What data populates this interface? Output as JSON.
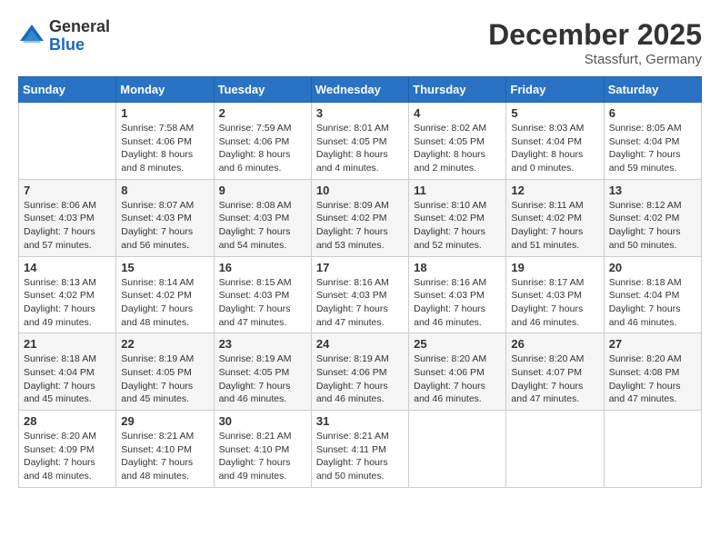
{
  "logo": {
    "general": "General",
    "blue": "Blue"
  },
  "title": "December 2025",
  "location": "Stassfurt, Germany",
  "days_header": [
    "Sunday",
    "Monday",
    "Tuesday",
    "Wednesday",
    "Thursday",
    "Friday",
    "Saturday"
  ],
  "weeks": [
    [
      {
        "day": "",
        "sunrise": "",
        "sunset": "",
        "daylight": ""
      },
      {
        "day": "1",
        "sunrise": "Sunrise: 7:58 AM",
        "sunset": "Sunset: 4:06 PM",
        "daylight": "Daylight: 8 hours and 8 minutes."
      },
      {
        "day": "2",
        "sunrise": "Sunrise: 7:59 AM",
        "sunset": "Sunset: 4:06 PM",
        "daylight": "Daylight: 8 hours and 6 minutes."
      },
      {
        "day": "3",
        "sunrise": "Sunrise: 8:01 AM",
        "sunset": "Sunset: 4:05 PM",
        "daylight": "Daylight: 8 hours and 4 minutes."
      },
      {
        "day": "4",
        "sunrise": "Sunrise: 8:02 AM",
        "sunset": "Sunset: 4:05 PM",
        "daylight": "Daylight: 8 hours and 2 minutes."
      },
      {
        "day": "5",
        "sunrise": "Sunrise: 8:03 AM",
        "sunset": "Sunset: 4:04 PM",
        "daylight": "Daylight: 8 hours and 0 minutes."
      },
      {
        "day": "6",
        "sunrise": "Sunrise: 8:05 AM",
        "sunset": "Sunset: 4:04 PM",
        "daylight": "Daylight: 7 hours and 59 minutes."
      }
    ],
    [
      {
        "day": "7",
        "sunrise": "Sunrise: 8:06 AM",
        "sunset": "Sunset: 4:03 PM",
        "daylight": "Daylight: 7 hours and 57 minutes."
      },
      {
        "day": "8",
        "sunrise": "Sunrise: 8:07 AM",
        "sunset": "Sunset: 4:03 PM",
        "daylight": "Daylight: 7 hours and 56 minutes."
      },
      {
        "day": "9",
        "sunrise": "Sunrise: 8:08 AM",
        "sunset": "Sunset: 4:03 PM",
        "daylight": "Daylight: 7 hours and 54 minutes."
      },
      {
        "day": "10",
        "sunrise": "Sunrise: 8:09 AM",
        "sunset": "Sunset: 4:02 PM",
        "daylight": "Daylight: 7 hours and 53 minutes."
      },
      {
        "day": "11",
        "sunrise": "Sunrise: 8:10 AM",
        "sunset": "Sunset: 4:02 PM",
        "daylight": "Daylight: 7 hours and 52 minutes."
      },
      {
        "day": "12",
        "sunrise": "Sunrise: 8:11 AM",
        "sunset": "Sunset: 4:02 PM",
        "daylight": "Daylight: 7 hours and 51 minutes."
      },
      {
        "day": "13",
        "sunrise": "Sunrise: 8:12 AM",
        "sunset": "Sunset: 4:02 PM",
        "daylight": "Daylight: 7 hours and 50 minutes."
      }
    ],
    [
      {
        "day": "14",
        "sunrise": "Sunrise: 8:13 AM",
        "sunset": "Sunset: 4:02 PM",
        "daylight": "Daylight: 7 hours and 49 minutes."
      },
      {
        "day": "15",
        "sunrise": "Sunrise: 8:14 AM",
        "sunset": "Sunset: 4:02 PM",
        "daylight": "Daylight: 7 hours and 48 minutes."
      },
      {
        "day": "16",
        "sunrise": "Sunrise: 8:15 AM",
        "sunset": "Sunset: 4:03 PM",
        "daylight": "Daylight: 7 hours and 47 minutes."
      },
      {
        "day": "17",
        "sunrise": "Sunrise: 8:16 AM",
        "sunset": "Sunset: 4:03 PM",
        "daylight": "Daylight: 7 hours and 47 minutes."
      },
      {
        "day": "18",
        "sunrise": "Sunrise: 8:16 AM",
        "sunset": "Sunset: 4:03 PM",
        "daylight": "Daylight: 7 hours and 46 minutes."
      },
      {
        "day": "19",
        "sunrise": "Sunrise: 8:17 AM",
        "sunset": "Sunset: 4:03 PM",
        "daylight": "Daylight: 7 hours and 46 minutes."
      },
      {
        "day": "20",
        "sunrise": "Sunrise: 8:18 AM",
        "sunset": "Sunset: 4:04 PM",
        "daylight": "Daylight: 7 hours and 46 minutes."
      }
    ],
    [
      {
        "day": "21",
        "sunrise": "Sunrise: 8:18 AM",
        "sunset": "Sunset: 4:04 PM",
        "daylight": "Daylight: 7 hours and 45 minutes."
      },
      {
        "day": "22",
        "sunrise": "Sunrise: 8:19 AM",
        "sunset": "Sunset: 4:05 PM",
        "daylight": "Daylight: 7 hours and 45 minutes."
      },
      {
        "day": "23",
        "sunrise": "Sunrise: 8:19 AM",
        "sunset": "Sunset: 4:05 PM",
        "daylight": "Daylight: 7 hours and 46 minutes."
      },
      {
        "day": "24",
        "sunrise": "Sunrise: 8:19 AM",
        "sunset": "Sunset: 4:06 PM",
        "daylight": "Daylight: 7 hours and 46 minutes."
      },
      {
        "day": "25",
        "sunrise": "Sunrise: 8:20 AM",
        "sunset": "Sunset: 4:06 PM",
        "daylight": "Daylight: 7 hours and 46 minutes."
      },
      {
        "day": "26",
        "sunrise": "Sunrise: 8:20 AM",
        "sunset": "Sunset: 4:07 PM",
        "daylight": "Daylight: 7 hours and 47 minutes."
      },
      {
        "day": "27",
        "sunrise": "Sunrise: 8:20 AM",
        "sunset": "Sunset: 4:08 PM",
        "daylight": "Daylight: 7 hours and 47 minutes."
      }
    ],
    [
      {
        "day": "28",
        "sunrise": "Sunrise: 8:20 AM",
        "sunset": "Sunset: 4:09 PM",
        "daylight": "Daylight: 7 hours and 48 minutes."
      },
      {
        "day": "29",
        "sunrise": "Sunrise: 8:21 AM",
        "sunset": "Sunset: 4:10 PM",
        "daylight": "Daylight: 7 hours and 48 minutes."
      },
      {
        "day": "30",
        "sunrise": "Sunrise: 8:21 AM",
        "sunset": "Sunset: 4:10 PM",
        "daylight": "Daylight: 7 hours and 49 minutes."
      },
      {
        "day": "31",
        "sunrise": "Sunrise: 8:21 AM",
        "sunset": "Sunset: 4:11 PM",
        "daylight": "Daylight: 7 hours and 50 minutes."
      },
      {
        "day": "",
        "sunrise": "",
        "sunset": "",
        "daylight": ""
      },
      {
        "day": "",
        "sunrise": "",
        "sunset": "",
        "daylight": ""
      },
      {
        "day": "",
        "sunrise": "",
        "sunset": "",
        "daylight": ""
      }
    ]
  ]
}
